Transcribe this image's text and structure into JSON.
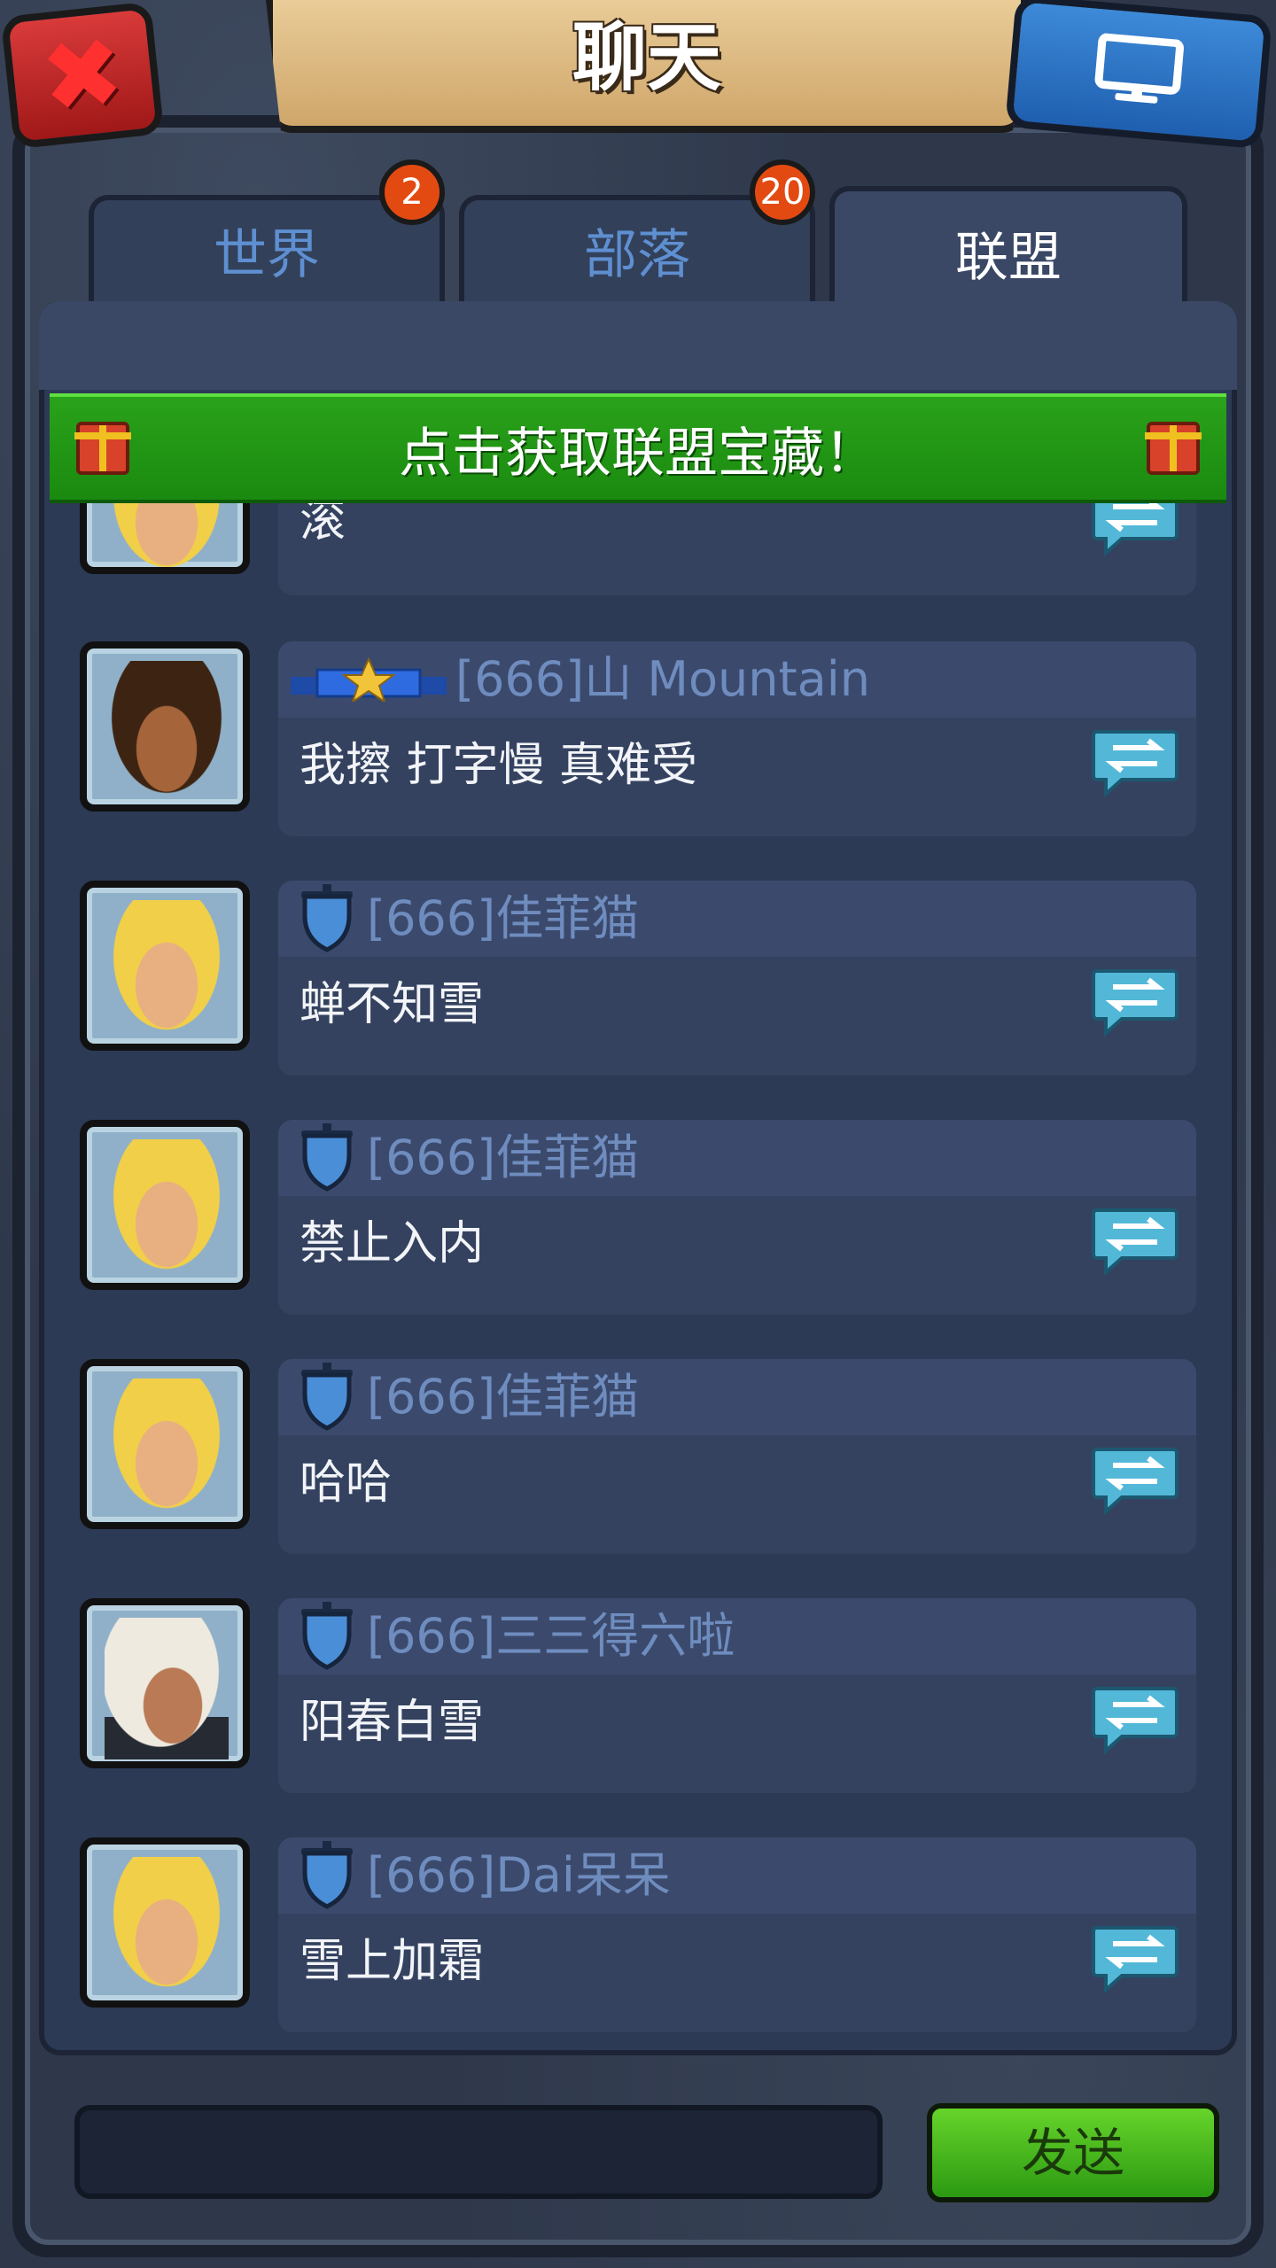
{
  "header": {
    "title": "聊天"
  },
  "tabs": [
    {
      "label": "世界",
      "badge": "2"
    },
    {
      "label": "部落",
      "badge": "20"
    },
    {
      "label": "联盟",
      "badge": ""
    }
  ],
  "banner": {
    "text": "点击获取联盟宝藏！"
  },
  "messages": [
    {
      "name": "",
      "text": "滚",
      "avatar": "blonde-face"
    },
    {
      "name": "[666]山 Mountain",
      "text": "我擦 打字慢 真难受",
      "avatar": "dark-face"
    },
    {
      "name": "[666]佳菲猫",
      "text": "蝉不知雪",
      "avatar": "blonde-face"
    },
    {
      "name": "[666]佳菲猫",
      "text": "禁止入内",
      "avatar": "blonde-face"
    },
    {
      "name": "[666]佳菲猫",
      "text": "哈哈",
      "avatar": "blonde-face"
    },
    {
      "name": "[666]三三得六啦",
      "text": "阳春白雪",
      "avatar": "white-hair-face"
    },
    {
      "name": "[666]Dai呆呆",
      "text": "雪上加霜",
      "avatar": "blonde-face"
    }
  ],
  "composer": {
    "input_value": "",
    "send_label": "发送"
  },
  "colors": {
    "banner": "#1f8f12",
    "send": "#3cb01c",
    "close": "#c62828",
    "screen": "#2a6fc4",
    "name": "#6f8cbf"
  },
  "icons": [
    "close-icon",
    "monitor-icon",
    "gift-icon",
    "reply-icon",
    "rank-shield-icon",
    "rank-banner-star-icon"
  ]
}
